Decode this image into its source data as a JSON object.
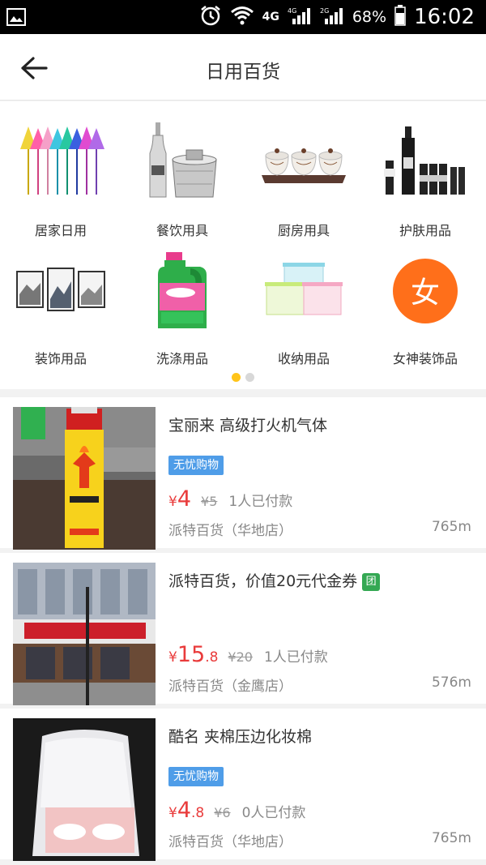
{
  "statusbar": {
    "network": "4G",
    "network_sub": "4G",
    "network_sub2": "2G",
    "battery": "68%",
    "time": "16:02"
  },
  "header": {
    "title": "日用百货"
  },
  "categories": [
    {
      "label": "居家日用",
      "icon": "umbrellas-icon"
    },
    {
      "label": "餐饮用具",
      "icon": "champagne-bucket-icon"
    },
    {
      "label": "厨房用具",
      "icon": "spice-jars-icon"
    },
    {
      "label": "护肤用品",
      "icon": "skincare-bottles-icon"
    },
    {
      "label": "装饰用品",
      "icon": "wall-paintings-icon"
    },
    {
      "label": "洗涤用品",
      "icon": "detergent-bottle-icon"
    },
    {
      "label": "收纳用品",
      "icon": "storage-boxes-icon"
    },
    {
      "label": "女神装饰品",
      "icon": "female-badge-icon",
      "badge_char": "女",
      "badge_color": "#ff6f1a"
    }
  ],
  "pager": {
    "pages": 2,
    "active": 0
  },
  "products": [
    {
      "title": "宝丽来  高级打火机气体",
      "tag": "无忧购物",
      "yen": "¥",
      "price_int": "4",
      "price_dec": "",
      "orig": "¥5",
      "sold": "1人已付款",
      "shop": "派特百货（华地店）",
      "distance": "765m"
    },
    {
      "title": "派特百货，价值20元代金券",
      "tuan": "团",
      "yen": "¥",
      "price_int": "15",
      "price_dec": ".8",
      "orig": "¥20",
      "sold": "1人已付款",
      "shop": "派特百货（金鹰店）",
      "distance": "576m"
    },
    {
      "title": "酷名  夹棉压边化妆棉",
      "tag": "无忧购物",
      "yen": "¥",
      "price_int": "4",
      "price_dec": ".8",
      "orig": "¥6",
      "sold": "0人已付款",
      "shop": "派特百货（华地店）",
      "distance": "765m"
    }
  ],
  "colors": {
    "accent_price": "#e93b3b",
    "tag_blue": "#4f9de8",
    "pager_active": "#ffc41a",
    "tuan_green": "#34a853"
  }
}
